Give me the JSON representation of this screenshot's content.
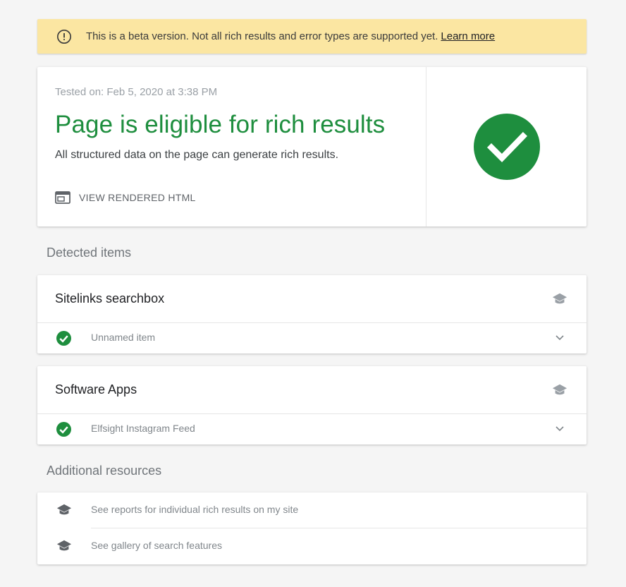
{
  "banner": {
    "message": "This is a beta version. Not all rich results and error types are supported yet.",
    "link_label": "Learn more",
    "icon": "info-icon"
  },
  "summary": {
    "tested_on": "Tested on: Feb 5, 2020 at 3:38 PM",
    "headline": "Page is eligible for rich results",
    "subtext": "All structured data on the page can generate rich results.",
    "view_html_label": "VIEW RENDERED HTML",
    "status_icon": "check-circle-icon",
    "status_color": "#1e8e3e"
  },
  "detected": {
    "section_title": "Detected items",
    "items": [
      {
        "title": "Sitelinks searchbox",
        "icon": "graduation-cap-icon",
        "row_label": "Unnamed item",
        "row_icon": "check-circle-icon"
      },
      {
        "title": "Software Apps",
        "icon": "graduation-cap-icon",
        "row_label": "Elfsight Instagram Feed",
        "row_icon": "check-circle-icon"
      }
    ]
  },
  "resources": {
    "section_title": "Additional resources",
    "items": [
      {
        "label": "See reports for individual rich results on my site",
        "icon": "graduation-cap-icon"
      },
      {
        "label": "See gallery of search features",
        "icon": "graduation-cap-icon"
      }
    ]
  },
  "colors": {
    "banner_bg": "#fbe6a2",
    "success_green": "#1e8e3e",
    "page_bg": "#f5f5f5"
  }
}
